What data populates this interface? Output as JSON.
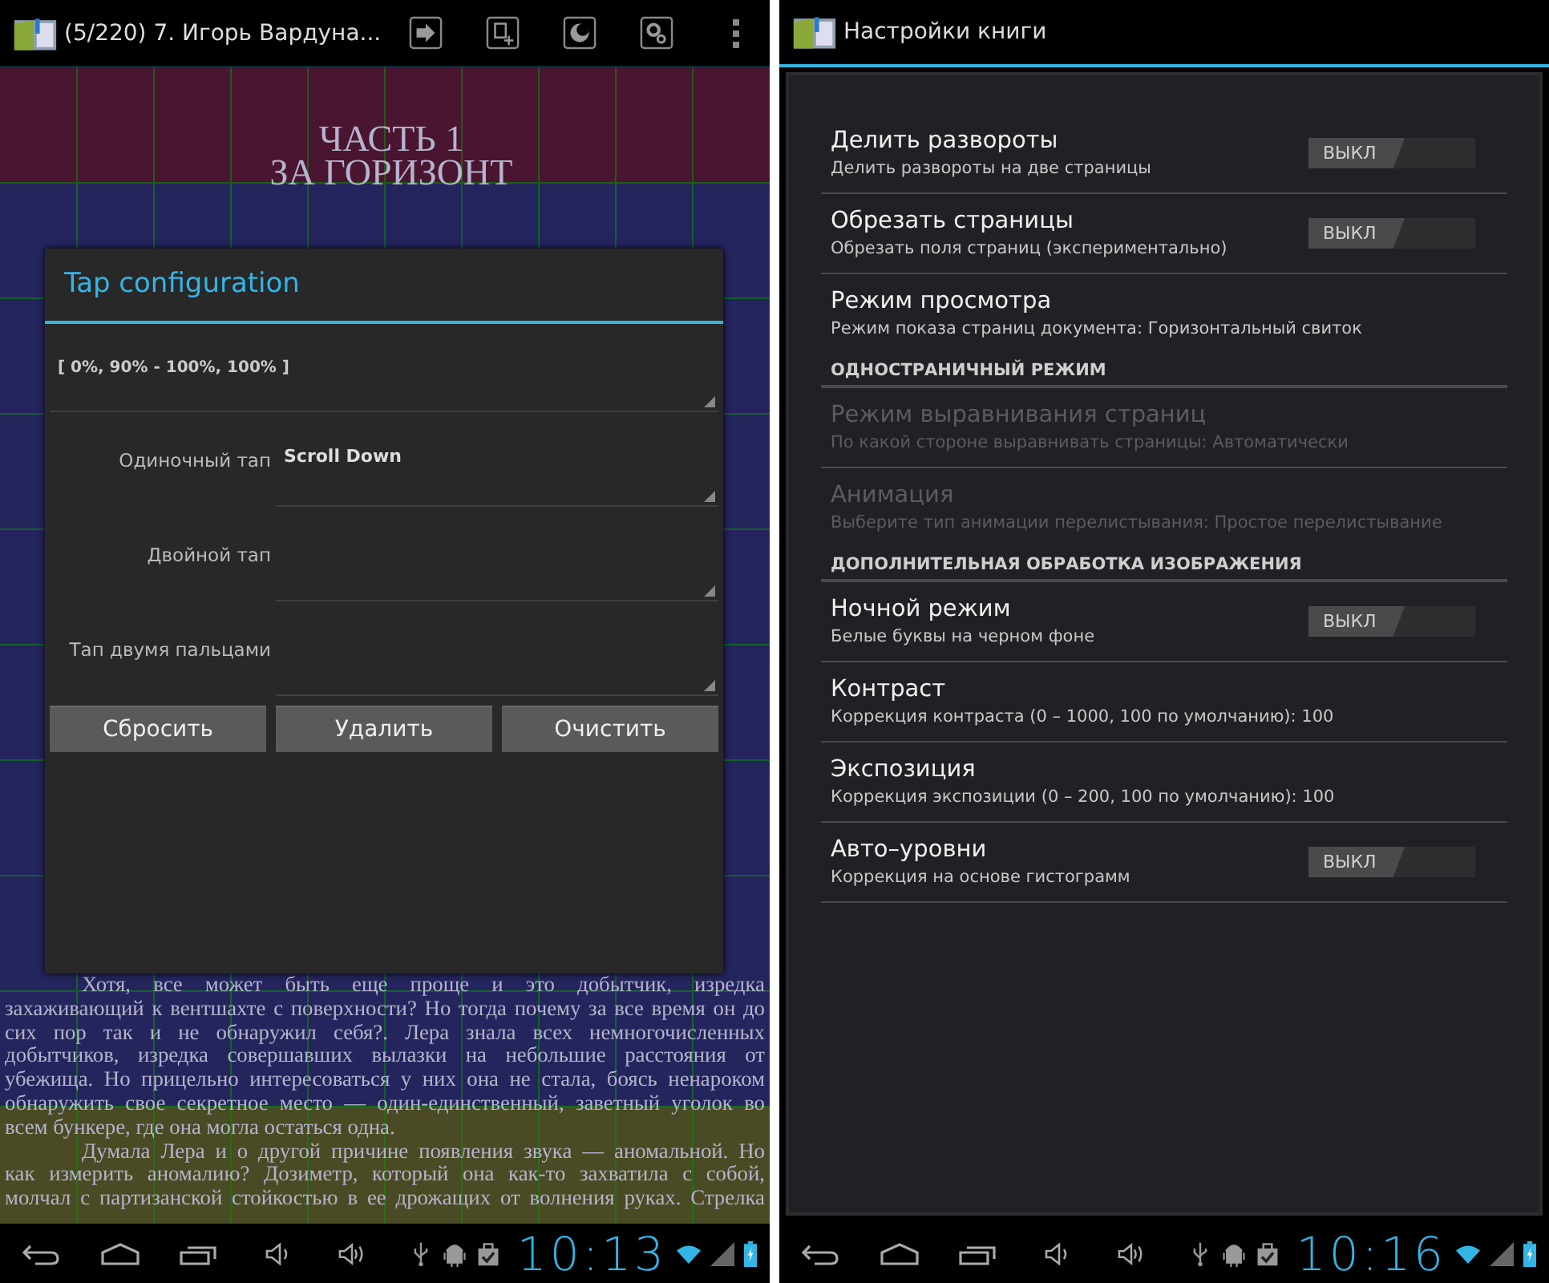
{
  "reader_screen": {
    "action_bar": {
      "title": "(5/220) 7. Игорь Вардуна..."
    },
    "book": {
      "heading": [
        "ЧАСТЬ 1",
        "ЗА ГОРИЗОНТ"
      ],
      "lines": [
        {
          "kind": "first",
          "text": "Хотя, все может быть еще проще и это добытчик, изредка"
        },
        {
          "kind": "middle",
          "text": "захаживающий к вентшахте с поверхности? Но тогда почему за все время он до"
        },
        {
          "kind": "middle",
          "text": "сих пор так и не обнаружил себя?. Лера знала всех немногочисленных"
        },
        {
          "kind": "middle",
          "text": "добытчиков, изредка совершавших вылазки на небольшие расстояния от"
        },
        {
          "kind": "middle",
          "text": "убежища. Но прицельно интересоваться у них она не стала, боясь ненароком"
        },
        {
          "kind": "middle",
          "text": "обнаружить свое секретное место — один-единственный, заветный уголок во"
        },
        {
          "kind": "last",
          "text": "всем бункере, где она могла остаться одна."
        },
        {
          "kind": "first",
          "text": "Думала Лера и о другой причине появления звука — аномальной. Но"
        },
        {
          "kind": "middle",
          "text": "как измерить аномалию? Дозиметр, который она как-то захватила с собой,"
        },
        {
          "kind": "middle",
          "text": "молчал с партизанской стойкостью в ее дрожащих от волнения руках. Стрелка"
        }
      ]
    },
    "tap_zone_rows": [
      {
        "color": "#4a1530"
      },
      {
        "color": "#25255e"
      },
      {
        "color": "#25255e"
      },
      {
        "color": "#25255e"
      },
      {
        "color": "#25255e"
      },
      {
        "color": "#25255e"
      },
      {
        "color": "#25255e"
      },
      {
        "color": "#25255e"
      },
      {
        "color": "#25255e"
      },
      {
        "color": "#4a4a25"
      }
    ],
    "dialog": {
      "title": "Tap configuration",
      "zone": "[ 0%, 90% - 100%, 100% ]",
      "rows": [
        {
          "label": "Одиночный тап",
          "value": "Scroll Down"
        },
        {
          "label": "Двойной тап"
        },
        {
          "label": "Тап двумя пальцами"
        }
      ],
      "buttons": [
        "Сбросить",
        "Удалить",
        "Очистить"
      ]
    },
    "nav_bar": {
      "time": "10:13"
    }
  },
  "settings_screen": {
    "action_bar": {
      "title": "Настройки книги"
    },
    "items": [
      {
        "kind": "toggle",
        "title": "Делить развороты",
        "summary": "Делить развороты на две страницы",
        "disabled": false,
        "checked": false,
        "toggle_label": "ВЫКЛ"
      },
      {
        "kind": "toggle",
        "title": "Обрезать страницы",
        "summary": "Обрезать поля страниц (экспериментально)",
        "disabled": false,
        "checked": false,
        "toggle_label": "ВЫКЛ"
      },
      {
        "kind": "plain",
        "title": "Режим просмотра",
        "summary": "Режим показа страниц документа: Горизонтальный свиток",
        "disabled": false
      },
      {
        "kind": "header",
        "title": "ОДНОСТРАНИЧНЫЙ РЕЖИМ"
      },
      {
        "kind": "plain",
        "title": "Режим выравнивания страниц",
        "summary": "По какой стороне выравнивать страницы: Автоматически",
        "disabled": true
      },
      {
        "kind": "plain",
        "title": "Анимация",
        "summary": "Выберите тип анимации перелистывания: Простое перелистывание",
        "disabled": true
      },
      {
        "kind": "header",
        "title": "ДОПОЛНИТЕЛЬНАЯ ОБРАБОТКА ИЗОБРАЖЕНИЯ"
      },
      {
        "kind": "toggle",
        "title": "Ночной режим",
        "summary": "Белые буквы на черном фоне",
        "disabled": false,
        "checked": false,
        "toggle_label": "ВЫКЛ"
      },
      {
        "kind": "plain",
        "title": "Контраст",
        "summary": "Коррекция контраста (0 – 1000, 100 по умолчанию): 100",
        "disabled": false
      },
      {
        "kind": "plain",
        "title": "Экспозиция",
        "summary": "Коррекция экспозиции (0 – 200, 100 по умолчанию): 100",
        "disabled": false
      },
      {
        "kind": "toggle",
        "title": "Авто–уровни",
        "summary": "Коррекция на основе гистограмм",
        "disabled": false,
        "checked": false,
        "toggle_label": "ВЫКЛ"
      }
    ],
    "nav_bar": {
      "time": "10:16"
    }
  }
}
